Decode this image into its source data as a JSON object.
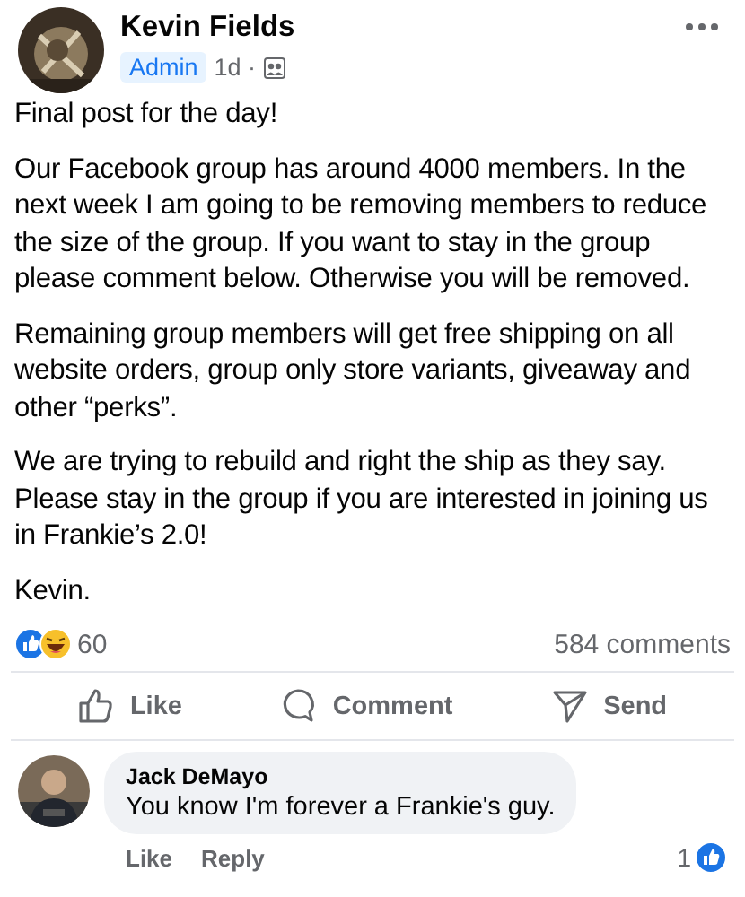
{
  "post": {
    "author": "Kevin Fields",
    "badge": "Admin",
    "time": "1d ·",
    "paragraphs": [
      "Final post for the day!",
      "Our Facebook group has around 4000 members. In the next week I am going to be removing members to reduce the size of the group. If you want to stay in the group please comment below. Otherwise you will be removed.",
      "Remaining group members will get free shipping on all website orders, group only store variants, giveaway and other “perks”.",
      "We are trying to rebuild and right the ship as they say. Please stay in the group if you are interested in joining us in Frankie’s 2.0!",
      "Kevin."
    ],
    "reaction_count": "60",
    "comment_count": "584 comments",
    "actions": [
      {
        "kind": "like",
        "label": "Like"
      },
      {
        "kind": "comment",
        "label": "Comment"
      },
      {
        "kind": "send",
        "label": "Send"
      }
    ]
  },
  "comment": {
    "author": "Jack DeMayo",
    "text": "You know I'm forever a Frankie's guy.",
    "actions": [
      "Like",
      "Reply"
    ],
    "likes": "1"
  }
}
